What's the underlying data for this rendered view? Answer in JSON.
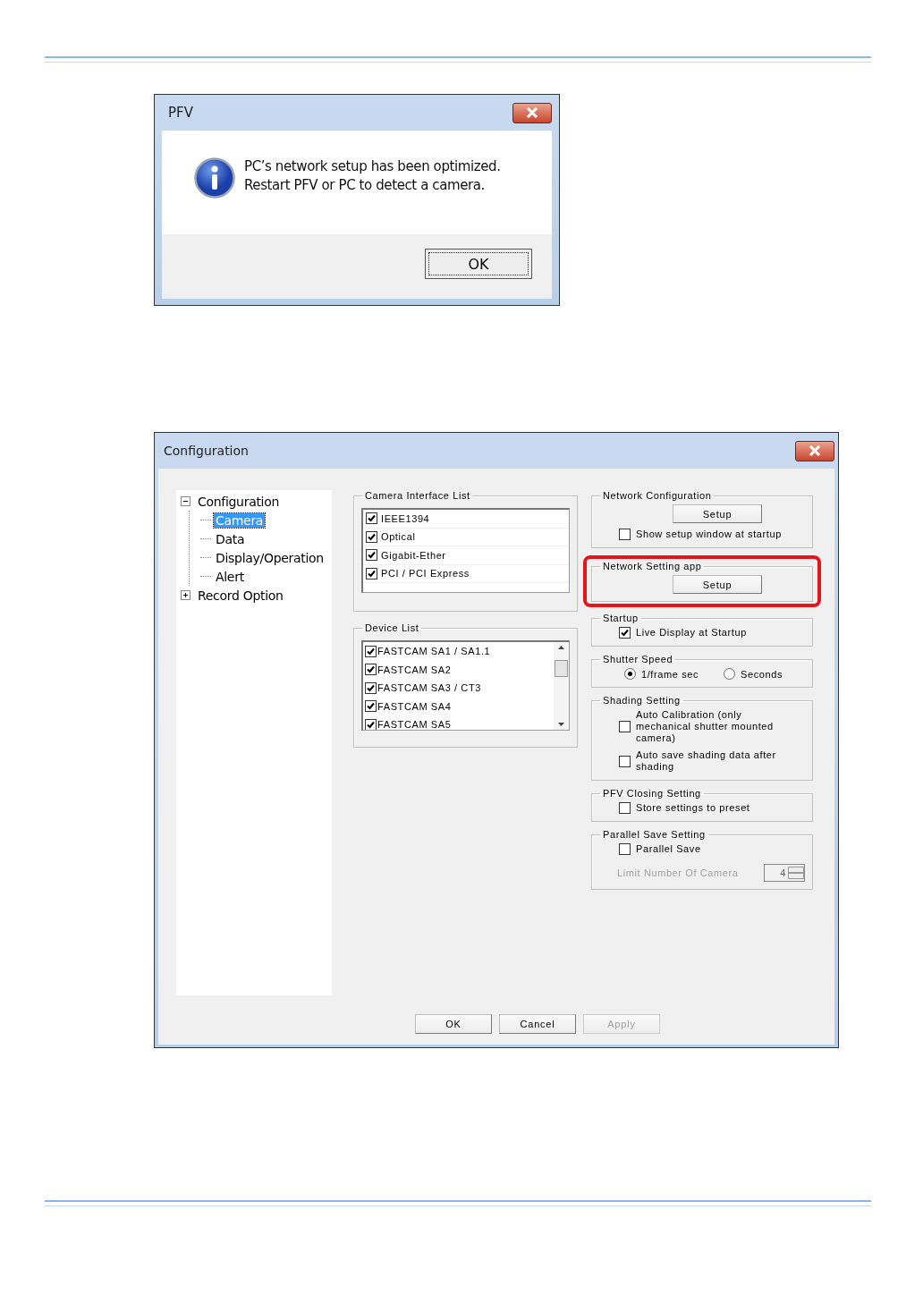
{
  "message_dialog": {
    "title": "PFV",
    "message": [
      "PC’s network setup has been optimized.",
      "Restart PFV or PC to detect a camera."
    ],
    "buttons": [
      {
        "label": "OK",
        "focused": true
      }
    ]
  },
  "config_dialog": {
    "title": "Configuration",
    "tree": [
      {
        "label": "Configuration",
        "expanded": true,
        "selected": false,
        "children": [
          {
            "label": "Camera",
            "selected": true
          },
          {
            "label": "Data",
            "selected": false
          },
          {
            "label": "Display/Operation",
            "selected": false
          },
          {
            "label": "Alert",
            "selected": false
          }
        ]
      },
      {
        "label": "Record Option",
        "expanded": false,
        "selected": false
      }
    ],
    "lists": [
      {
        "title": "Camera Interface List",
        "scrollbar": false,
        "items": [
          {
            "label": "IEEE1394",
            "checked": true
          },
          {
            "label": "Optical",
            "checked": true
          },
          {
            "label": "Gigabit-Ether",
            "checked": true
          },
          {
            "label": "PCI / PCI Express",
            "checked": true
          }
        ]
      },
      {
        "title": "Device List",
        "scrollbar": true,
        "items": [
          {
            "label": "FASTCAM SA1 / SA1.1",
            "checked": true
          },
          {
            "label": "FASTCAM SA2",
            "checked": true
          },
          {
            "label": "FASTCAM SA3 / CT3",
            "checked": true
          },
          {
            "label": "FASTCAM SA4",
            "checked": true
          },
          {
            "label": "FASTCAM SA5",
            "checked": true
          }
        ]
      }
    ],
    "groups": [
      {
        "title": "Network Configuration",
        "highlighted": false,
        "controls": [
          {
            "kind": "button",
            "label": "Setup"
          },
          {
            "kind": "checkbox",
            "label": "Show setup window at startup",
            "checked": false
          }
        ]
      },
      {
        "title": "Network Setting app",
        "highlighted": true,
        "controls": [
          {
            "kind": "button",
            "label": "Setup"
          }
        ]
      },
      {
        "title": "Startup",
        "highlighted": false,
        "controls": [
          {
            "kind": "checkbox",
            "label": "Live Display at Startup",
            "checked": true
          }
        ]
      },
      {
        "title": "Shutter Speed",
        "highlighted": false,
        "controls": [
          {
            "kind": "radios",
            "options": [
              {
                "label": "1/frame sec",
                "selected": true
              },
              {
                "label": "Seconds",
                "selected": false
              }
            ]
          }
        ]
      },
      {
        "title": "Shading Setting",
        "highlighted": false,
        "controls": [
          {
            "kind": "checkbox",
            "label": "Auto Calibration (only mechanical shutter mounted camera)",
            "checked": false
          },
          {
            "kind": "checkbox",
            "label": "Auto save shading data after shading",
            "checked": false
          }
        ]
      },
      {
        "title": "PFV Closing Setting",
        "highlighted": false,
        "controls": [
          {
            "kind": "checkbox",
            "label": "Store settings to preset",
            "checked": false
          }
        ]
      },
      {
        "title": "Parallel Save Setting",
        "highlighted": false,
        "controls": [
          {
            "kind": "checkbox",
            "label": "Parallel Save",
            "checked": false
          },
          {
            "kind": "spinner",
            "label": "Limit Number Of Camera",
            "value": "4",
            "disabled": true
          }
        ]
      }
    ],
    "buttons": [
      {
        "label": "OK",
        "disabled": false
      },
      {
        "label": "Cancel",
        "disabled": false
      },
      {
        "label": "Apply",
        "disabled": true
      }
    ]
  }
}
